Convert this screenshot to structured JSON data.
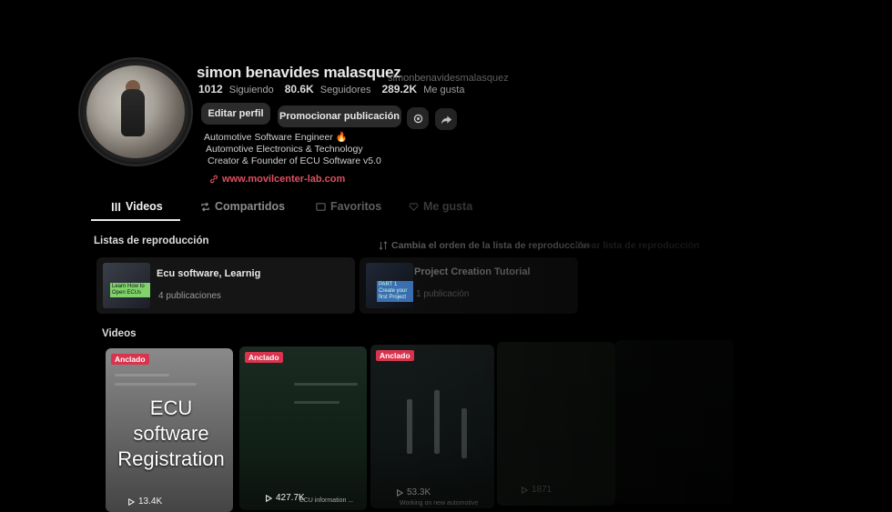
{
  "profile": {
    "display_name": "simon benavides malasquez",
    "handle": "simonbenavidesmalasquez",
    "stats": [
      {
        "value": "1012",
        "label": "Siguiendo"
      },
      {
        "value": "80.6K",
        "label": "Seguidores"
      },
      {
        "value": "289.2K",
        "label": "Me gusta"
      }
    ],
    "edit_label": "Editar perfil",
    "promote_label": "Promocionar publicación",
    "bio": [
      "Automotive Software Engineer 🔥",
      "Automotive Electronics & Technology",
      "Creator & Founder of ECU Software v5.0"
    ],
    "link": "www.movilcenter-lab.com",
    "icons": {
      "settings": "gear-icon",
      "share": "share-icon",
      "link": "link-icon"
    }
  },
  "tabs": [
    {
      "label": "Videos",
      "icon": "grid-icon",
      "active": true
    },
    {
      "label": "Compartidos",
      "icon": "repost-icon",
      "active": false
    },
    {
      "label": "Favoritos",
      "icon": "bookmark-icon",
      "active": false
    },
    {
      "label": "Me gusta",
      "icon": "heart-icon",
      "active": false
    }
  ],
  "playlists": {
    "title": "Listas de reproducción",
    "reorder_label": "Cambia el orden de la lista de reproducción",
    "create_label": "Crear lista de reproducción",
    "items": [
      {
        "title": "Ecu software, Learnig",
        "count": "4 publicaciones",
        "thumb_tag": "Learn How to Open ECUs"
      },
      {
        "title": "Project Creation Tutorial",
        "count": "1 publicación",
        "thumb_tag": "PART 1 Create your first Project"
      }
    ]
  },
  "videos": {
    "title": "Videos",
    "items": [
      {
        "badge": "Anclado",
        "overlay": "ECU software Registration",
        "views": "13.4K",
        "caption": ""
      },
      {
        "badge": "Anclado",
        "overlay": "",
        "views": "427.7K",
        "caption": "ECU information ..."
      },
      {
        "badge": "Anclado",
        "overlay": "",
        "views": "53.3K",
        "caption": "Working on new automotive"
      },
      {
        "badge": "",
        "overlay": "",
        "views": "1871",
        "caption": ""
      },
      {
        "badge": "",
        "overlay": "",
        "views": "",
        "caption": ""
      }
    ]
  },
  "colors": {
    "accent": "#e0505f",
    "pinned_badge": "#d8344d",
    "background": "#000000"
  }
}
